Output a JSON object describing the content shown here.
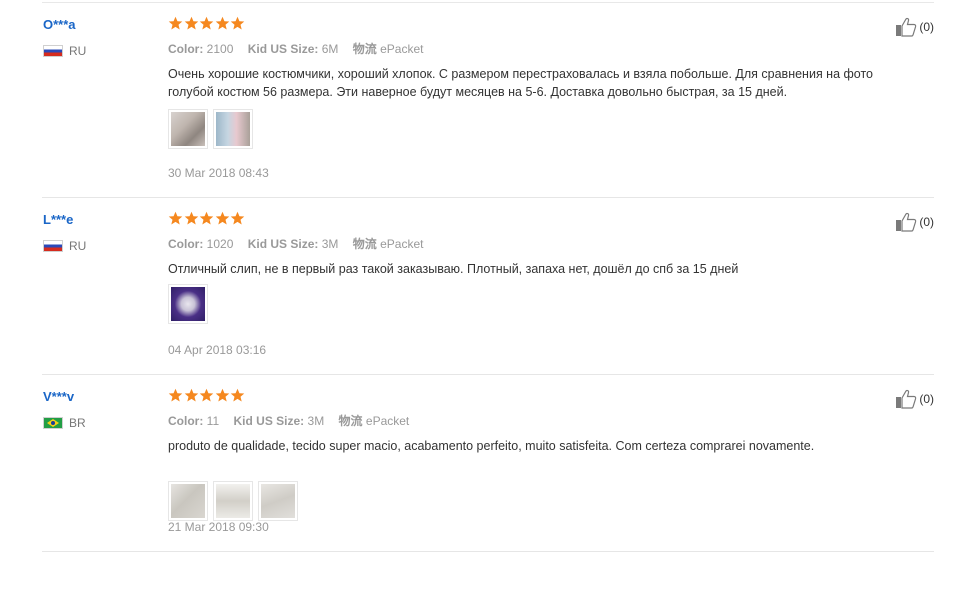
{
  "reviews": [
    {
      "user": "O***a",
      "country": "RU",
      "flag_icon": "russia-flag-icon",
      "rating": 5,
      "color_label": "Color:",
      "color_value": "2100",
      "size_label": "Kid US Size:",
      "size_value": "6M",
      "shipping_label": "物流",
      "shipping_value": "ePacket",
      "text": "Очень хорошие костюмчики, хороший хлопок. С размером перестраховалась и взяла побольше. Для сравнения на фото голубой костюм 56 размера. Эти наверное будут месяцев на 5-6. Доставка довольно быстрая, за 15 дней.",
      "photos": [
        "photo-thumbnail",
        "photo-thumbnail"
      ],
      "date": "30 Mar 2018 08:43",
      "helpful_count": "(0)"
    },
    {
      "user": "L***e",
      "country": "RU",
      "flag_icon": "russia-flag-icon",
      "rating": 5,
      "color_label": "Color:",
      "color_value": "1020",
      "size_label": "Kid US Size:",
      "size_value": "3M",
      "shipping_label": "物流",
      "shipping_value": "ePacket",
      "text": "Отличный слип, не в первый раз такой заказываю. Плотный, запаха нет, дошёл до спб за 15 дней",
      "photos": [
        "photo-thumbnail"
      ],
      "date": "04 Apr 2018 03:16",
      "helpful_count": "(0)"
    },
    {
      "user": "V***v",
      "country": "BR",
      "flag_icon": "brazil-flag-icon",
      "rating": 5,
      "color_label": "Color:",
      "color_value": "11",
      "size_label": "Kid US Size:",
      "size_value": "3M",
      "shipping_label": "物流",
      "shipping_value": "ePacket",
      "text": "produto de qualidade, tecido super macio, acabamento perfeito, muito satisfeita. Com certeza comprarei novamente.",
      "photos": [
        "photo-thumbnail",
        "photo-thumbnail",
        "photo-thumbnail"
      ],
      "date": "21 Mar 2018 09:30",
      "helpful_count": "(0)"
    }
  ],
  "colors": {
    "username": "#1a66c7",
    "star": "#f5881f",
    "meta_text": "#999999",
    "divider": "#e6e6e6"
  },
  "icons": {
    "star": "star-icon",
    "helpful": "thumbs-up-icon"
  }
}
